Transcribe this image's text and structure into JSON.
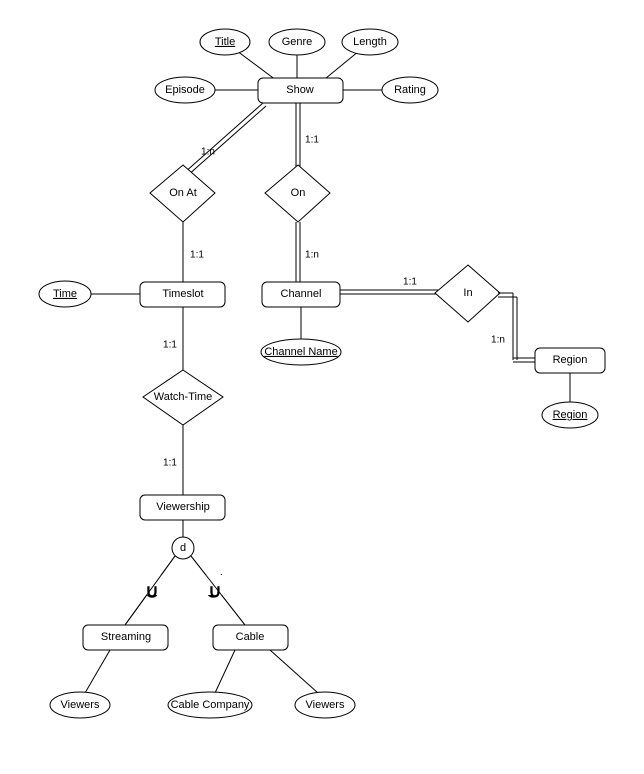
{
  "entities": {
    "show": "Show",
    "timeslot": "Timeslot",
    "channel": "Channel",
    "region": "Region",
    "viewership": "Viewership",
    "streaming": "Streaming",
    "cable": "Cable"
  },
  "relationships": {
    "on_at": "On At",
    "on": "On",
    "in": "In",
    "watch_time": "Watch-Time"
  },
  "attributes": {
    "title": "Title",
    "genre": "Genre",
    "length": "Length",
    "episode": "Episode",
    "rating": "Rating",
    "time": "Time",
    "channel_name": "Channel Name",
    "region_attr": "Region",
    "viewers_streaming": "Viewers",
    "cable_company": "Cable Company",
    "viewers_cable": "Viewers"
  },
  "cardinalities": {
    "show_onat": "1:n",
    "onat_timeslot": "1:1",
    "show_on": "1:1",
    "on_channel": "1:n",
    "channel_in": "1:1",
    "in_region": "1:n",
    "timeslot_watchtime": "1:1",
    "watchtime_viewership": "1:1"
  },
  "disjoint": "d"
}
